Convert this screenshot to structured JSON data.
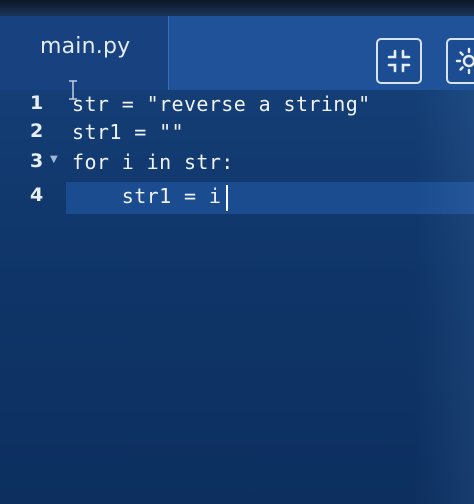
{
  "editor": {
    "filename": "main.py",
    "lines": [
      {
        "number": "1",
        "code": "str = \"reverse a string\""
      },
      {
        "number": "2",
        "code": "str1 = \"\""
      },
      {
        "number": "3",
        "code": "for i in str:",
        "foldable": true
      },
      {
        "number": "4",
        "code": "    str1 = i",
        "active": true
      }
    ]
  },
  "toolbar": {
    "collapse_icon": "collapse-icon",
    "theme_icon": "sun-icon"
  },
  "colors": {
    "background": "#0f3568",
    "tab_bar": "#1d4f95",
    "active_line": "#1b4c90",
    "text": "#eef3fb"
  }
}
